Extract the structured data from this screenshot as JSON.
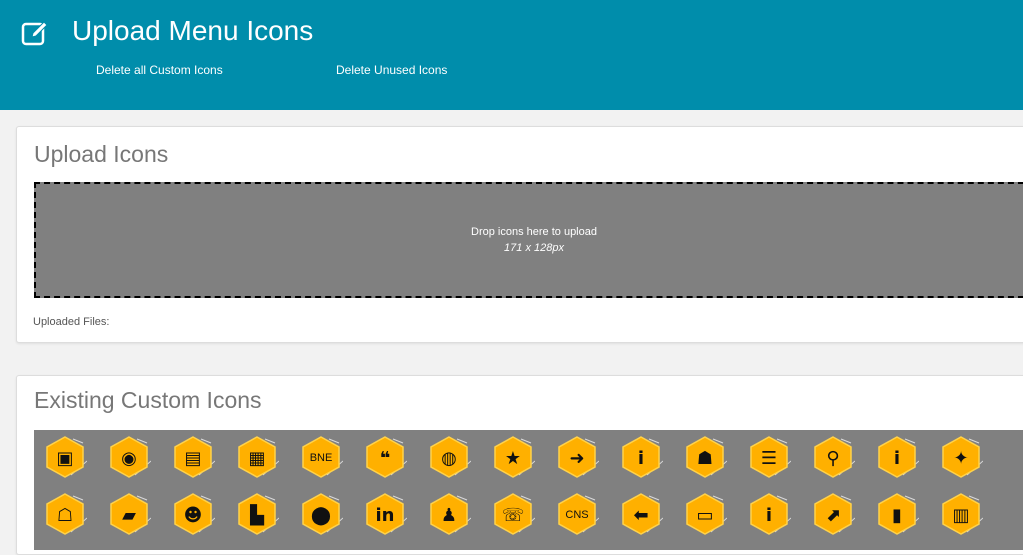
{
  "header": {
    "title": "Upload Menu Icons",
    "actions": [
      "Delete all Custom Icons",
      "Delete Unused Icons"
    ],
    "icon": "edit-icon",
    "background_color": "#008dab"
  },
  "upload": {
    "title": "Upload Icons",
    "drop_text": "Drop icons here to upload",
    "size_hint": "171 x 128px",
    "uploaded_label": "Uploaded Files:"
  },
  "existing": {
    "title": "Existing Custom Icons",
    "icon_color": "#ffb000",
    "rows": [
      [
        {
          "name": "image-icon",
          "glyph": "▣"
        },
        {
          "name": "camera-icon",
          "glyph": "◉"
        },
        {
          "name": "document-icon",
          "glyph": "▤"
        },
        {
          "name": "id-card-icon",
          "glyph": "▦"
        },
        {
          "name": "bne-icon",
          "text": "BNE"
        },
        {
          "name": "quote-icon",
          "glyph": "❝"
        },
        {
          "name": "globe-icon",
          "glyph": "◍"
        },
        {
          "name": "star-icon",
          "glyph": "★"
        },
        {
          "name": "arrow-right-icon",
          "glyph": "➜"
        },
        {
          "name": "info-icon",
          "glyph": "i"
        },
        {
          "name": "users-icon",
          "glyph": "☗"
        },
        {
          "name": "list-icon",
          "glyph": "☰"
        },
        {
          "name": "map-pin-icon",
          "glyph": "⚲"
        },
        {
          "name": "info-icon",
          "glyph": "i"
        },
        {
          "name": "twitter-icon",
          "glyph": "✦"
        }
      ],
      [
        {
          "name": "presenter-icon",
          "glyph": "☖"
        },
        {
          "name": "ticket-icon",
          "glyph": "▰"
        },
        {
          "name": "group-icon",
          "glyph": "☻"
        },
        {
          "name": "folder-upload-icon",
          "glyph": "▙"
        },
        {
          "name": "location-icon",
          "glyph": "⬤"
        },
        {
          "name": "linkedin-icon",
          "glyph": "in"
        },
        {
          "name": "hiker-icon",
          "glyph": "♟"
        },
        {
          "name": "speaker-icon",
          "glyph": "☏"
        },
        {
          "name": "cns-icon",
          "text": "CNS"
        },
        {
          "name": "arrow-left-icon",
          "glyph": "⬅"
        },
        {
          "name": "monitor-icon",
          "glyph": "▭"
        },
        {
          "name": "info-icon",
          "glyph": "i"
        },
        {
          "name": "external-link-icon",
          "glyph": "⬈"
        },
        {
          "name": "bookmark-icon",
          "glyph": "▮"
        },
        {
          "name": "archive-icon",
          "glyph": "▥"
        }
      ]
    ]
  }
}
